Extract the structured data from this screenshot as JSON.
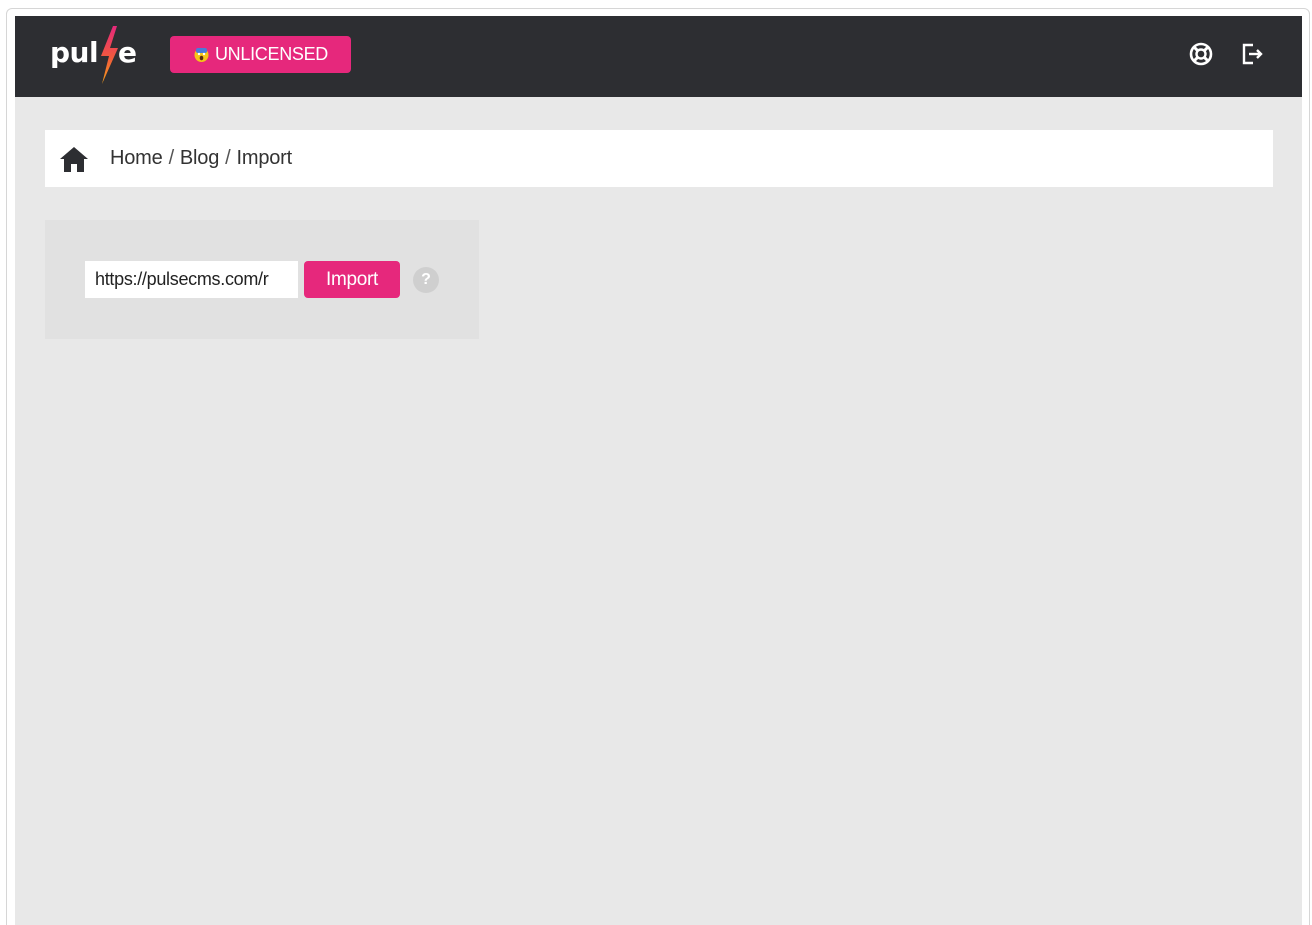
{
  "brand": {
    "logo_left": "pul",
    "logo_right": "e",
    "license_badge": "UNLICENSED"
  },
  "header": {
    "help_icon": "lifebuoy-icon",
    "logout_icon": "logout-icon"
  },
  "breadcrumb": {
    "items": [
      "Home",
      "Blog",
      "Import"
    ],
    "separator": "/"
  },
  "import": {
    "url_value": "https://pulsecms.com/r",
    "button_label": "Import",
    "help_glyph": "?"
  },
  "colors": {
    "topbar": "#2d2e32",
    "accent": "#e6287c",
    "background": "#e8e8e8"
  }
}
